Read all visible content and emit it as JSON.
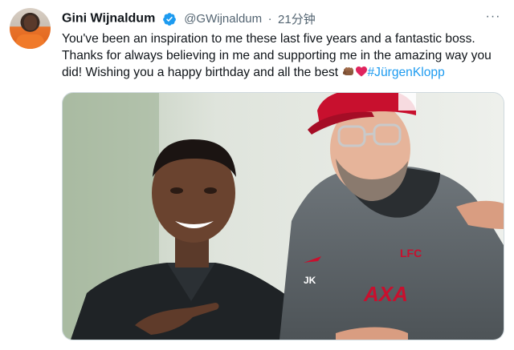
{
  "author": {
    "display_name": "Gini Wijnaldum",
    "handle": "@GWijnaldum",
    "separator": "·",
    "timestamp": "21分钟",
    "verified": true
  },
  "tweet": {
    "text_before": "You've been an inspiration to me these last five years and a fantastic boss. Thanks for always believing in me and supporting me in the amazing way you did! Wishing you a happy birthday and all the best",
    "emojis": [
      "fist-bump-emoji",
      "red-heart-emoji"
    ],
    "hashtag": "#JürgenKlopp"
  },
  "more_label": "···",
  "colors": {
    "link": "#1d9bf0",
    "secondary_text": "#536471",
    "verified": "#1d9bf0",
    "liverpool_red": "#c8102e"
  },
  "media": {
    "description_icon": "photo"
  }
}
